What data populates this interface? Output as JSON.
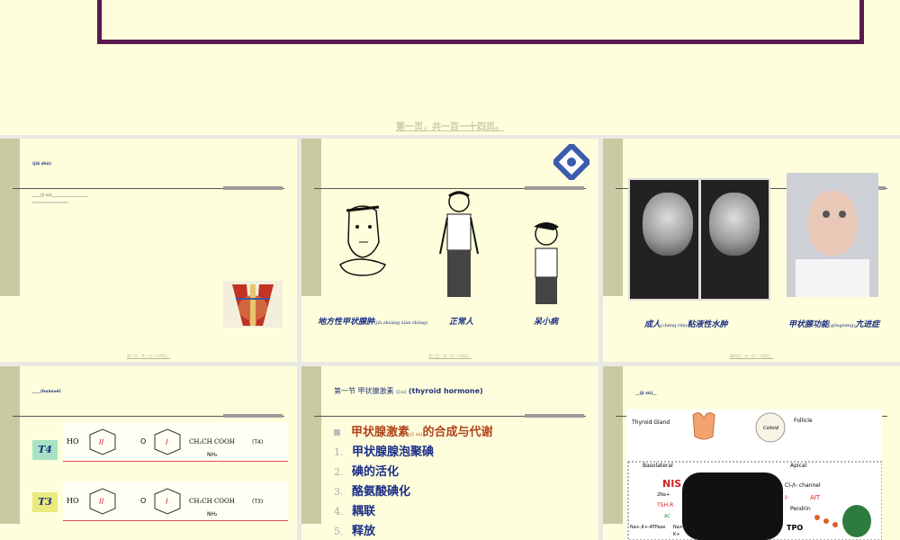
{
  "page_label": "第一页，共一百一十四页。",
  "slides": {
    "s1": {
      "title_small": "(jiǎ shū)",
      "body_small": "____(jì sù)__________________",
      "footer": "第二页，共一百一十四页。"
    },
    "s2": {
      "captions": [
        "地方性甲状腺肿",
        "(jiǎ zhuàng xiàn zhǒng)",
        "正常人",
        "呆小病"
      ],
      "footer": "第三页，共一百一十四页。"
    },
    "s3": {
      "captions": [
        "成人",
        "(chéng rén)",
        "粘液性水肿",
        "甲状腺功能",
        "(gōngnéng)",
        "亢进症"
      ],
      "footer": "第四页，共一百一十四页。"
    },
    "s4": {
      "title_small": "____(huàxué)",
      "badges": [
        "T4",
        "T3"
      ],
      "labels": [
        "(T4)",
        "(T3)"
      ]
    },
    "s5": {
      "header": "第一节  甲状腺激素",
      "header_en": "(thyroid hormone)",
      "header_pinyin": "(jī sù)",
      "items": [
        {
          "num": "",
          "text": "甲状腺激素",
          "pinyin": "(jī sù)",
          "tail": "的合成与代谢"
        },
        {
          "num": "1.",
          "text": "甲状腺腺泡聚碘"
        },
        {
          "num": "2.",
          "text": "碘的活化"
        },
        {
          "num": "3.",
          "text": "酪氨酸碘化"
        },
        {
          "num": "4.",
          "text": "耦联"
        },
        {
          "num": "5.",
          "text": "释放"
        }
      ]
    },
    "s6": {
      "title_small": "__(jì sù)__",
      "labels": [
        "Thyroid Gland",
        "Follicle",
        "Colloid",
        "Basolateral",
        "Apical",
        "NIS",
        "Cl-/I- channel",
        "2Na+",
        "I-",
        "AIT",
        "TSH-R",
        "Pendrin",
        "AC",
        "Na+,K+-ATPase",
        "Na+",
        "K+",
        "TPO"
      ]
    }
  }
}
